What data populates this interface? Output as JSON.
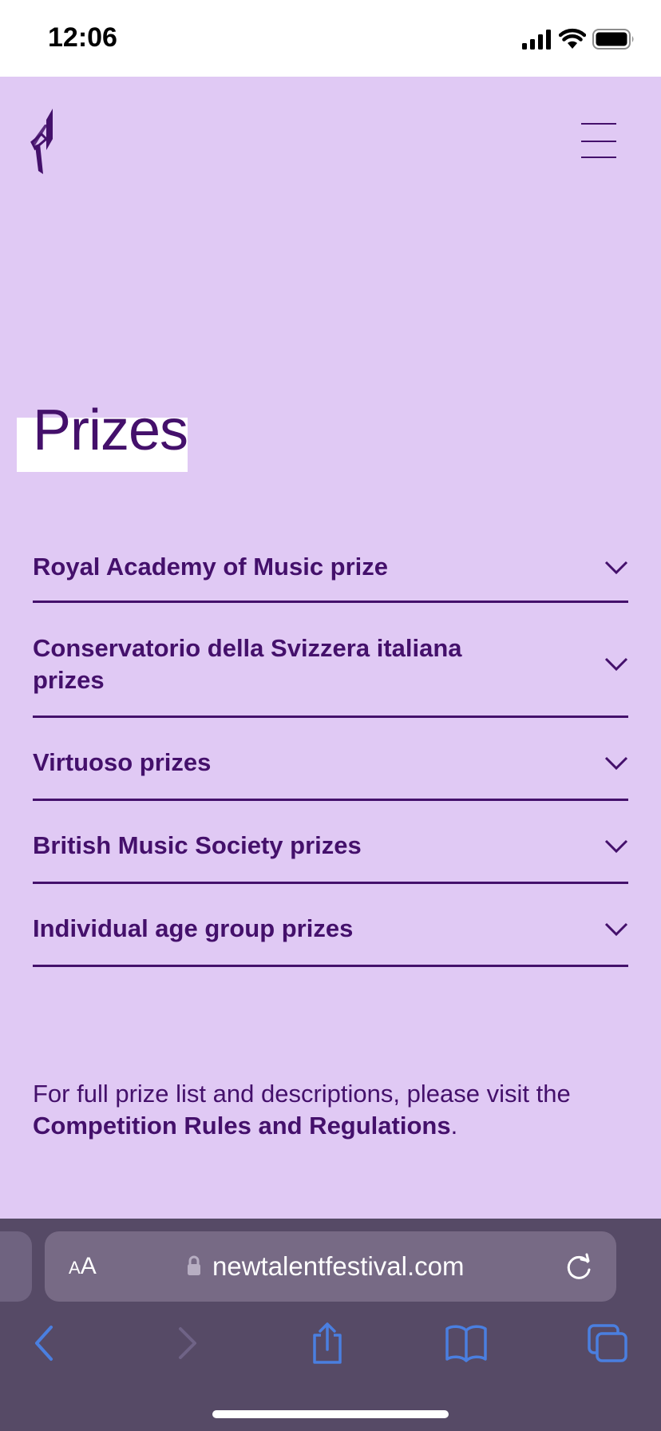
{
  "status_bar": {
    "time": "12:06"
  },
  "page": {
    "title": "Prizes"
  },
  "accordion": {
    "items": [
      {
        "label": "Royal Academy of Music prize"
      },
      {
        "label": "Conservatorio della Svizzera italiana prizes"
      },
      {
        "label": "Virtuoso prizes"
      },
      {
        "label": "British Music Society prizes"
      },
      {
        "label": "Individual age group prizes"
      }
    ]
  },
  "footer": {
    "text_before": "For full prize list and descriptions, please visit the ",
    "link_text": "Competition Rules and Regulations",
    "text_after": "."
  },
  "browser": {
    "text_size_label_small": "A",
    "text_size_label_large": "A",
    "url": "newtalentfestival.com"
  },
  "colors": {
    "background": "#e0c9f4",
    "accent": "#44106b",
    "browser_chrome": "#564a66",
    "url_bar": "#776a85",
    "toolbar_icon": "#4a7fe0"
  }
}
